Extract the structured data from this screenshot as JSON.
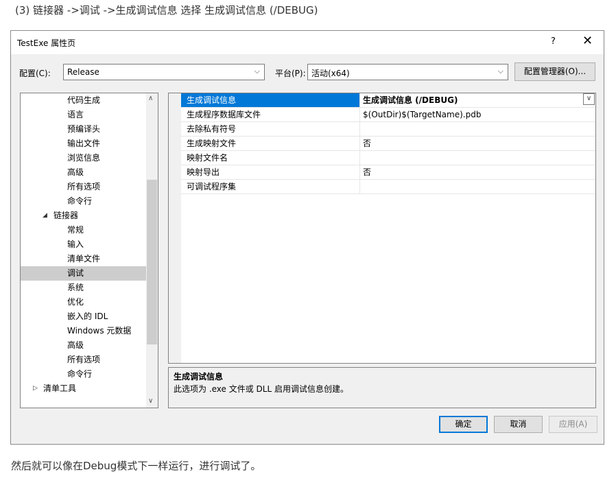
{
  "page": {
    "caption_top": "(3) 链接器 ->调试 ->生成调试信息 选择 生成调试信息 (/DEBUG)",
    "caption_bottom": "然后就可以像在Debug模式下一样运行，进行调试了。"
  },
  "dialog": {
    "title": "TestExe 属性页",
    "help": "?",
    "close": "✕"
  },
  "toolbar": {
    "config_label": "配置(C):",
    "config_value": "Release",
    "platform_label": "平台(P):",
    "platform_value": "活动(x64)",
    "config_manager": "配置管理器(O)...",
    "dropdown_glyph": "⌵"
  },
  "tree": {
    "items": [
      {
        "label": "代码生成"
      },
      {
        "label": "语言"
      },
      {
        "label": "预编译头"
      },
      {
        "label": "输出文件"
      },
      {
        "label": "浏览信息"
      },
      {
        "label": "高级"
      },
      {
        "label": "所有选项"
      },
      {
        "label": "命令行"
      },
      {
        "label": "链接器",
        "toggle": "◢"
      },
      {
        "label": "常规"
      },
      {
        "label": "输入"
      },
      {
        "label": "清单文件"
      },
      {
        "label": "调试"
      },
      {
        "label": "系统"
      },
      {
        "label": "优化"
      },
      {
        "label": "嵌入的 IDL"
      },
      {
        "label": "Windows 元数据"
      },
      {
        "label": "高级"
      },
      {
        "label": "所有选项"
      },
      {
        "label": "命令行"
      },
      {
        "label": "清单工具",
        "toggle": "▷"
      }
    ],
    "scroll_up": "∧",
    "scroll_down": "∨"
  },
  "grid": {
    "rows": [
      {
        "name": "生成调试信息",
        "value": "生成调试信息 (/DEBUG)"
      },
      {
        "name": "生成程序数据库文件",
        "value": "$(OutDir)$(TargetName).pdb"
      },
      {
        "name": "去除私有符号",
        "value": ""
      },
      {
        "name": "生成映射文件",
        "value": "否"
      },
      {
        "name": "映射文件名",
        "value": ""
      },
      {
        "name": "映射导出",
        "value": "否"
      },
      {
        "name": "可调试程序集",
        "value": ""
      }
    ],
    "dropdown_glyph": "∨"
  },
  "description": {
    "title": "生成调试信息",
    "body": "此选项为 .exe 文件或 DLL 启用调试信息创建。"
  },
  "buttons": {
    "ok": "确定",
    "cancel": "取消",
    "apply": "应用(A)"
  }
}
